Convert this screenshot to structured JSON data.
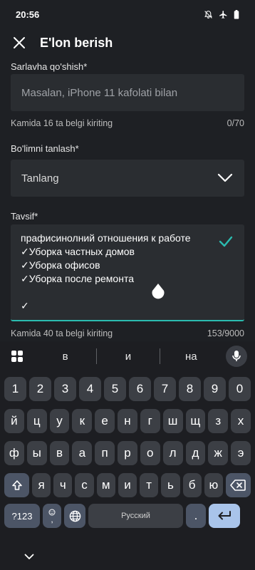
{
  "status_bar": {
    "time": "20:56",
    "icons": [
      "mute-icon",
      "airplane-icon",
      "battery-icon"
    ]
  },
  "app_bar": {
    "title": "E'lon berish",
    "close_icon": "close-icon"
  },
  "title_field": {
    "label": "Sarlavha qo'shish*",
    "placeholder": "Masalan, iPhone 11 kafolati bilan",
    "helper": "Kamida 16 ta belgi kiriting",
    "counter": "0/70"
  },
  "category_field": {
    "label": "Bo'limni tanlash*",
    "value": "Tanlang"
  },
  "description_field": {
    "label": "Tavsif*",
    "lines": [
      "прафисинолний отношения к работе",
      "✓Уборка частных домов",
      "✓Уборка офисов",
      "✓Уборка после ремонта",
      "",
      "✓"
    ],
    "helper": "Kamida 40 ta belgi kiriting",
    "counter": "153/9000"
  },
  "keyboard": {
    "suggestions": [
      "в",
      "и",
      "на"
    ],
    "row1": [
      "1",
      "2",
      "3",
      "4",
      "5",
      "6",
      "7",
      "8",
      "9",
      "0"
    ],
    "row2": [
      "й",
      "ц",
      "у",
      "к",
      "е",
      "н",
      "г",
      "ш",
      "щ",
      "з",
      "х"
    ],
    "row3": [
      "ф",
      "ы",
      "в",
      "а",
      "п",
      "р",
      "о",
      "л",
      "д",
      "ж",
      "э"
    ],
    "row4": [
      "я",
      "ч",
      "с",
      "м",
      "и",
      "т",
      "ь",
      "б",
      "ю"
    ],
    "symbols_label": "?123",
    "emoji_label": ",",
    "space_label": "Русский",
    "period_label": "."
  },
  "colors": {
    "accent": "#2bbcb0",
    "background": "#1e2024",
    "field": "#2a2d31"
  }
}
